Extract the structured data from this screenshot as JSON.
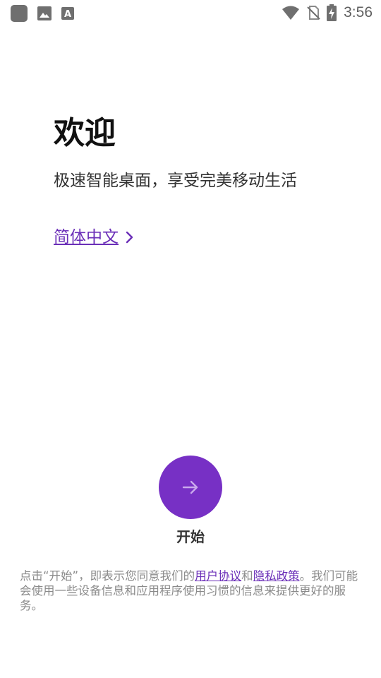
{
  "status_bar": {
    "time": "3:56",
    "left_icons": [
      "app-icon",
      "image-icon",
      "text-icon"
    ],
    "right_icons": [
      "wifi-icon",
      "no-sim-icon",
      "battery-charging-icon"
    ]
  },
  "welcome": {
    "title": "欢迎",
    "subtitle": "极速智能桌面，享受完美移动生活"
  },
  "language": {
    "label": "简体中文"
  },
  "start": {
    "label": "开始"
  },
  "terms": {
    "prefix": "点击“开始”，即表示您同意我们的",
    "user_agreement": "用户协议",
    "and": "和",
    "privacy_policy": "隐私政策",
    "suffix": "。我们可能会使用一些设备信息和应用程序使用习惯的信息来提供更好的服务。"
  },
  "colors": {
    "accent": "#7730c5",
    "link": "#6b2fb8",
    "muted_text": "#8a8a8a"
  }
}
